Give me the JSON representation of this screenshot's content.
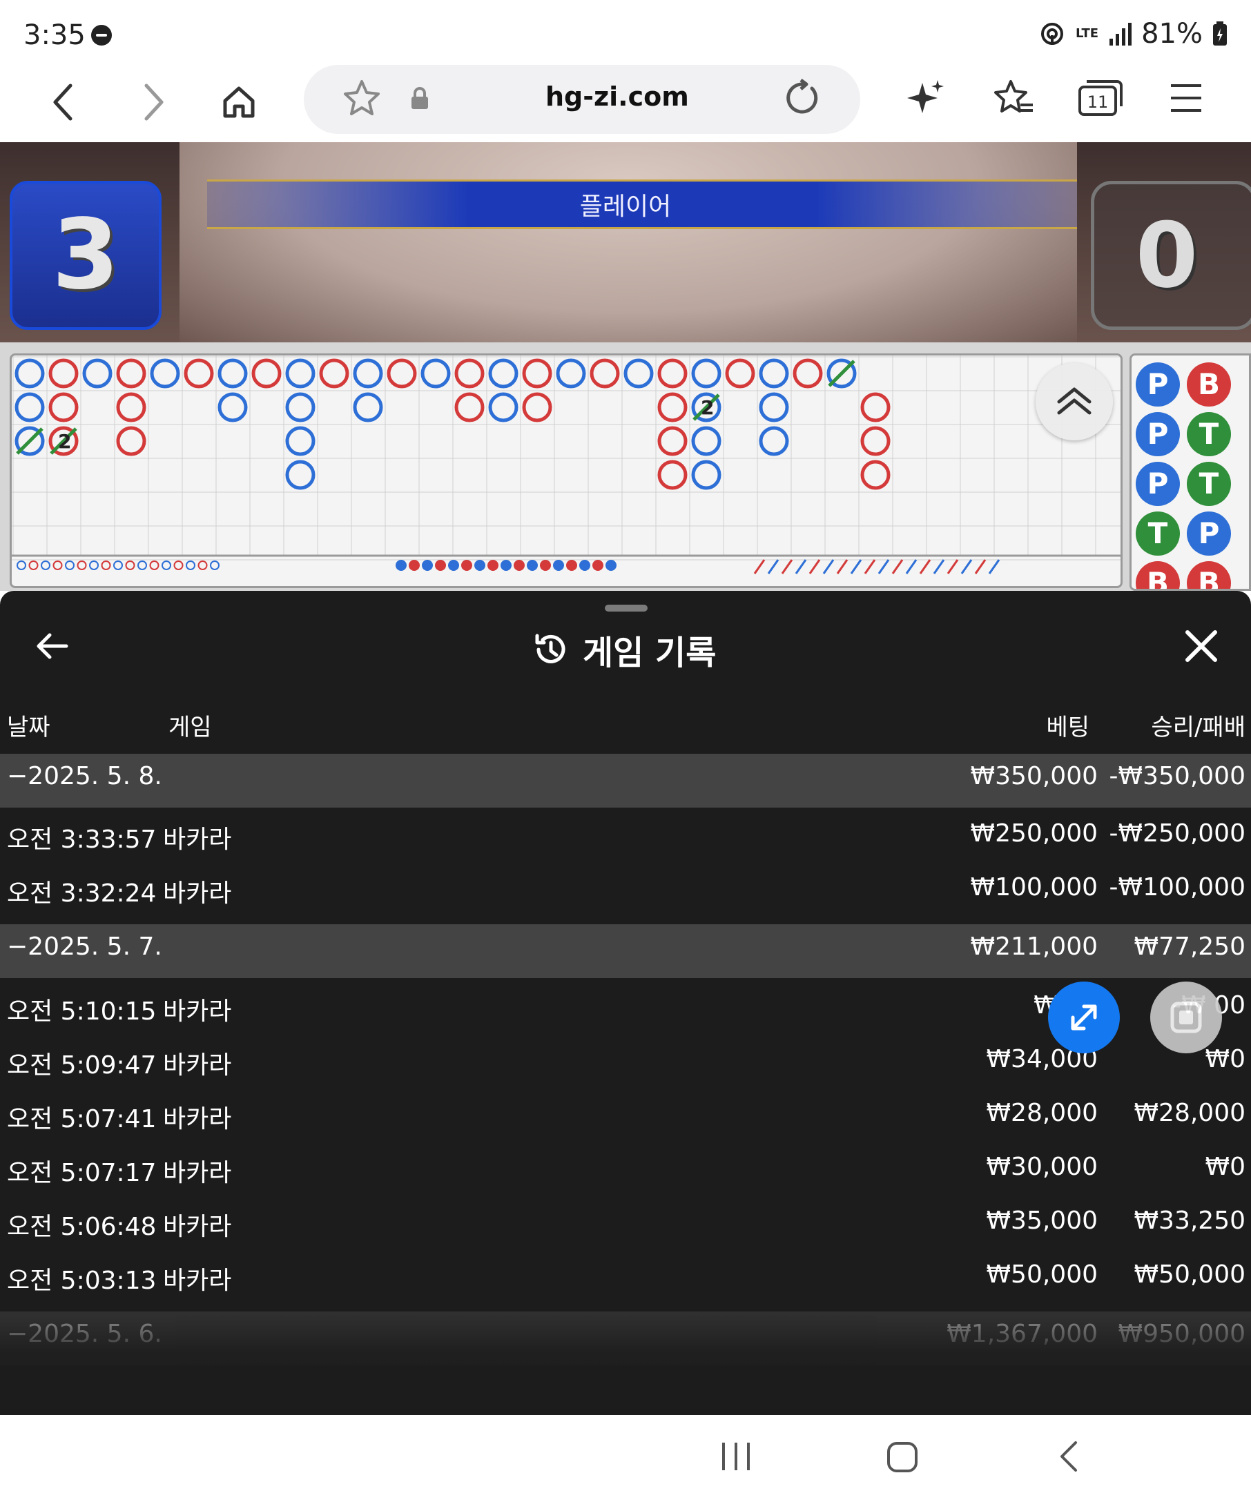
{
  "status_bar": {
    "time": "3:35",
    "network": "LTE",
    "battery": "81%"
  },
  "browser": {
    "url": "hg-zi.com",
    "tab_count": "11"
  },
  "game": {
    "player_label": "플레이어",
    "player_score": "3",
    "banker_score": "0",
    "bead_plate": [
      [
        "P",
        "B"
      ],
      [
        "P",
        "T"
      ],
      [
        "P",
        "T"
      ],
      [
        "T",
        "P"
      ],
      [
        "B",
        "B"
      ]
    ],
    "big_road_tie_count": "2"
  },
  "history": {
    "title": "게임 기록",
    "columns": {
      "date": "날짜",
      "game": "게임",
      "bet": "베팅",
      "win_loss": "승리/패배"
    },
    "rows": [
      {
        "type": "date",
        "date": "−2025. 5. 8.",
        "bet": "₩350,000",
        "win_loss": "-₩350,000"
      },
      {
        "type": "item",
        "date": "오전 3:33:57",
        "game": "바카라",
        "bet": "₩250,000",
        "win_loss": "-₩250,000"
      },
      {
        "type": "item",
        "date": "오전 3:32:24",
        "game": "바카라",
        "bet": "₩100,000",
        "win_loss": "-₩100,000"
      },
      {
        "type": "date",
        "date": "−2025. 5. 7.",
        "bet": "₩211,000",
        "win_loss": "₩77,250"
      },
      {
        "type": "item",
        "date": "오전 5:10:15",
        "game": "바카라",
        "bet": "₩34,",
        "win_loss": "-₩       00"
      },
      {
        "type": "item",
        "date": "오전 5:09:47",
        "game": "바카라",
        "bet": "₩34,000",
        "win_loss": "₩0"
      },
      {
        "type": "item",
        "date": "오전 5:07:41",
        "game": "바카라",
        "bet": "₩28,000",
        "win_loss": "₩28,000"
      },
      {
        "type": "item",
        "date": "오전 5:07:17",
        "game": "바카라",
        "bet": "₩30,000",
        "win_loss": "₩0"
      },
      {
        "type": "item",
        "date": "오전 5:06:48",
        "game": "바카라",
        "bet": "₩35,000",
        "win_loss": "₩33,250"
      },
      {
        "type": "item",
        "date": "오전 5:03:13",
        "game": "바카라",
        "bet": "₩50,000",
        "win_loss": "₩50,000"
      },
      {
        "type": "date",
        "date": "−2025. 5. 6.",
        "bet": "₩1,367,000",
        "win_loss": "₩950,000"
      }
    ]
  },
  "colors": {
    "player_blue": "#2d6fd6",
    "banker_red": "#d43a3a",
    "tie_green": "#2f8f3a",
    "sheet_bg": "#1c1c1c",
    "date_row_bg": "#444444",
    "expand_button": "#1479f0"
  },
  "icons": {
    "back": "arrow-left-icon",
    "forward": "arrow-right-icon",
    "home": "home-icon",
    "bookmark": "star-icon",
    "lock": "lock-icon",
    "reload": "reload-icon",
    "ai": "sparkle-icon",
    "bookmarks": "star-list-icon",
    "tabs": "tabs-icon",
    "menu": "hamburger-icon",
    "history": "history-icon",
    "close": "close-icon",
    "expand": "expand-icon",
    "pip": "pip-icon"
  }
}
